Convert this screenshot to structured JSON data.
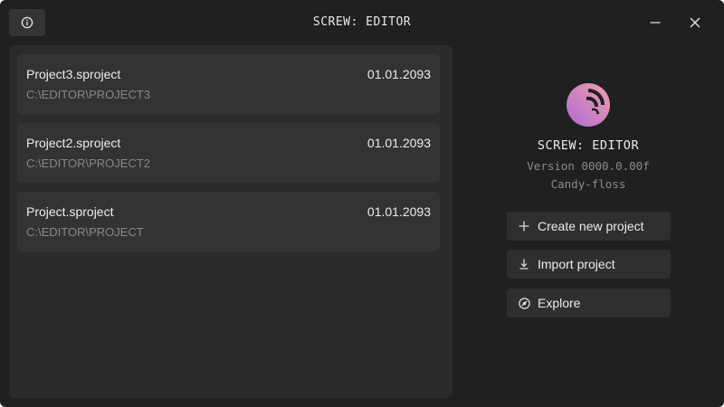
{
  "window": {
    "title": "SCREW: EDITOR"
  },
  "projects": [
    {
      "name": "Project3.sproject",
      "date": "01.01.2093",
      "path": "C:\\EDITOR\\PROJECT3"
    },
    {
      "name": "Project2.sproject",
      "date": "01.01.2093",
      "path": "C:\\EDITOR\\PROJECT2"
    },
    {
      "name": "Project.sproject",
      "date": "01.01.2093",
      "path": "C:\\EDITOR\\PROJECT"
    }
  ],
  "about": {
    "app_name": "SCREW: EDITOR",
    "version": "Version 0000.0.00f",
    "codename": "Candy-floss"
  },
  "actions": {
    "create": {
      "label": "Create new project",
      "icon": "plus-icon"
    },
    "import": {
      "label": "Import project",
      "icon": "download-icon"
    },
    "explore": {
      "label": "Explore",
      "icon": "compass-icon"
    }
  },
  "colors": {
    "background": "#202020",
    "panel": "#2b2b2b",
    "card": "#333333",
    "button": "#2f2f2f",
    "text": "#ececec",
    "muted_text": "#878787",
    "logo_gradient_start": "#b06ad8",
    "logo_gradient_end": "#f0a0a8"
  }
}
